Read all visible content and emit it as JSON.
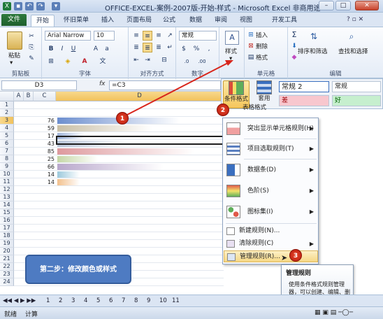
{
  "titlebar": {
    "title": "OFFICE-EXCEL-案例-2007版-开始-样式 - Microsoft Excel 非商用途",
    "min": "–",
    "max": "□",
    "close": "✕"
  },
  "tabs": {
    "file": "文件",
    "items": [
      "开始",
      "怀旧菜单",
      "插入",
      "页面布局",
      "公式",
      "数据",
      "审阅",
      "视图",
      "开发工具"
    ]
  },
  "ribbon": {
    "clipboard": {
      "label": "剪贴板",
      "paste": "粘贴"
    },
    "font": {
      "label": "字体",
      "name": "Arial Narrow",
      "size": "10"
    },
    "align": {
      "label": "对齐方式"
    },
    "number": {
      "label": "数字",
      "format": "常规"
    },
    "styles_btn": "样式",
    "cells": {
      "label": "单元格",
      "insert": "插入",
      "delete": "删除",
      "format": "格式"
    },
    "editing": {
      "label": "编辑",
      "sort": "排序和筛选",
      "find": "查找和选择",
      "sigma": "Σ"
    }
  },
  "formula_bar": {
    "name_box": "D3",
    "fx": "fx",
    "formula": "=C3"
  },
  "style_gallery": {
    "cond_format": "条件格式",
    "table_format_1": "套用",
    "table_format_2": "表格格式",
    "normal2": "常规 2",
    "normal": "常规",
    "bad": "差",
    "good": "好"
  },
  "columns": [
    "A",
    "B",
    "C",
    "D"
  ],
  "rows": [
    "1",
    "2",
    "3",
    "4",
    "5",
    "6",
    "7",
    "8",
    "9",
    "10",
    "11",
    "12",
    "13",
    "14",
    "15",
    "16",
    "17",
    "18",
    "19",
    "20",
    "21",
    "22",
    "23",
    "24"
  ],
  "chart_data": {
    "type": "bar",
    "values": [
      76,
      59,
      17,
      43,
      85,
      25,
      66,
      14,
      14
    ],
    "colors": [
      "#6d8fcf",
      "#c9bfa6",
      "#9fb3d9",
      "#b7c4d6",
      "#de9a9e",
      "#c5d7a6",
      "#b9a8cc",
      "#9cc9dc",
      "#f2c08c"
    ]
  },
  "menu": {
    "items": [
      {
        "label": "突出显示单元格规则(H)",
        "icon": "highlight-rules-icon"
      },
      {
        "label": "项目选取规则(T)",
        "icon": "top-bottom-rules-icon"
      },
      {
        "label": "数据条(D)",
        "icon": "data-bars-icon"
      },
      {
        "label": "色阶(S)",
        "icon": "color-scales-icon"
      },
      {
        "label": "图标集(I)",
        "icon": "icon-sets-icon"
      }
    ],
    "new_rule": "新建规则(N)...",
    "clear_rules": "清除规则(C)",
    "manage_rules": "管理规则(R)..."
  },
  "tooltip": {
    "title": "管理规则",
    "body": "使用条件格式规则管理器，可以创建、编辑、删除和查看工作簿中的所有条件格式规则。"
  },
  "step_box": "第二步：修改颜色或样式",
  "badges": [
    "1",
    "2",
    "3"
  ],
  "sheet_tabs": [
    "1",
    "2",
    "3",
    "4",
    "5",
    "6",
    "7",
    "8",
    "9",
    "10",
    "11"
  ],
  "status": {
    "ready": "就绪",
    "calc": "计算"
  }
}
